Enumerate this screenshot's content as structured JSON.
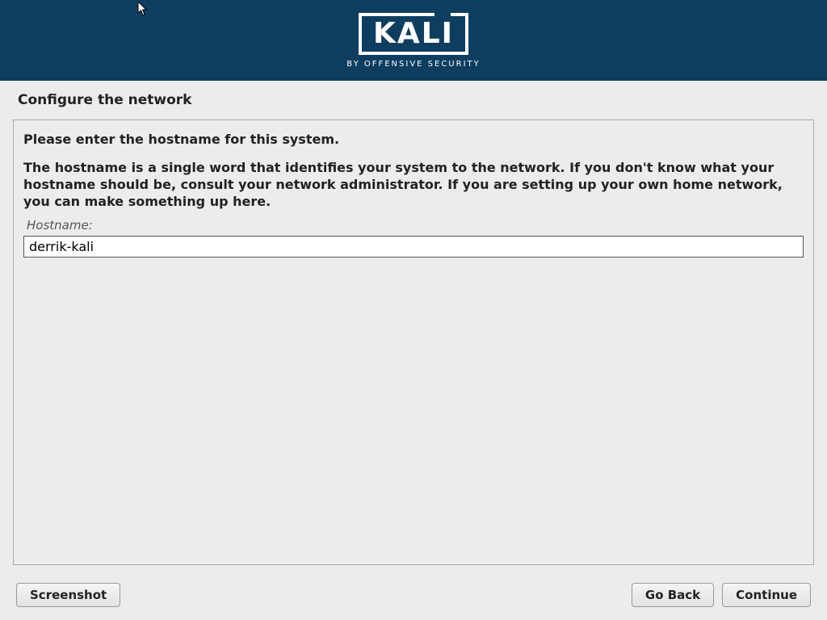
{
  "header": {
    "logo_main": "KALI",
    "logo_sub": "BY OFFENSIVE SECURITY"
  },
  "page": {
    "title": "Configure the network",
    "prompt": "Please enter the hostname for this system.",
    "description": "The hostname is a single word that identifies your system to the network. If you don't know what your hostname should be, consult your network administrator. If you are setting up your own home network, you can make something up here.",
    "field_label": "Hostname:",
    "hostname_value": "derrik-kali"
  },
  "buttons": {
    "screenshot": "Screenshot",
    "go_back": "Go Back",
    "continue": "Continue"
  }
}
